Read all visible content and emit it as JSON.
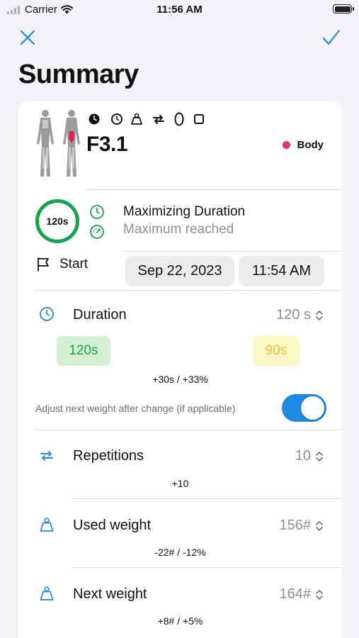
{
  "status_bar": {
    "carrier": "Carrier",
    "time": "11:56 AM"
  },
  "nav": {
    "title": "Summary",
    "close_icon": "close-icon",
    "done_icon": "checkmark-icon"
  },
  "exercise": {
    "code": "F3.1",
    "category": "Body",
    "category_color": "#ee2a7b",
    "set_icons": [
      "timer-filled-icon",
      "clock-icon",
      "weight-icon",
      "repeat-icon",
      "oval-icon",
      "square-icon"
    ]
  },
  "goal": {
    "ring_value": "120s",
    "ring_color": "#16a34a",
    "title": "Maximizing Duration",
    "subtitle": "Maximum reached"
  },
  "start": {
    "label": "Start",
    "date": "Sep 22, 2023",
    "time": "11:54 AM"
  },
  "duration": {
    "label": "Duration",
    "value": "120 s",
    "current": "120s",
    "previous": "90s",
    "delta": "+30s / +33%",
    "adjust_label": "Adjust next weight after change (if applicable)",
    "adjust_enabled": true
  },
  "repetitions": {
    "label": "Repetitions",
    "value": "10",
    "delta": "+10"
  },
  "used_weight": {
    "label": "Used weight",
    "value": "156#",
    "delta": "-22# / -12%"
  },
  "next_weight": {
    "label": "Next weight",
    "value": "164#",
    "delta": "+8# / +5%"
  },
  "colors": {
    "accent_blue": "#1e88e5",
    "green": "#16a34a",
    "yellow_text": "#e0c63a"
  }
}
